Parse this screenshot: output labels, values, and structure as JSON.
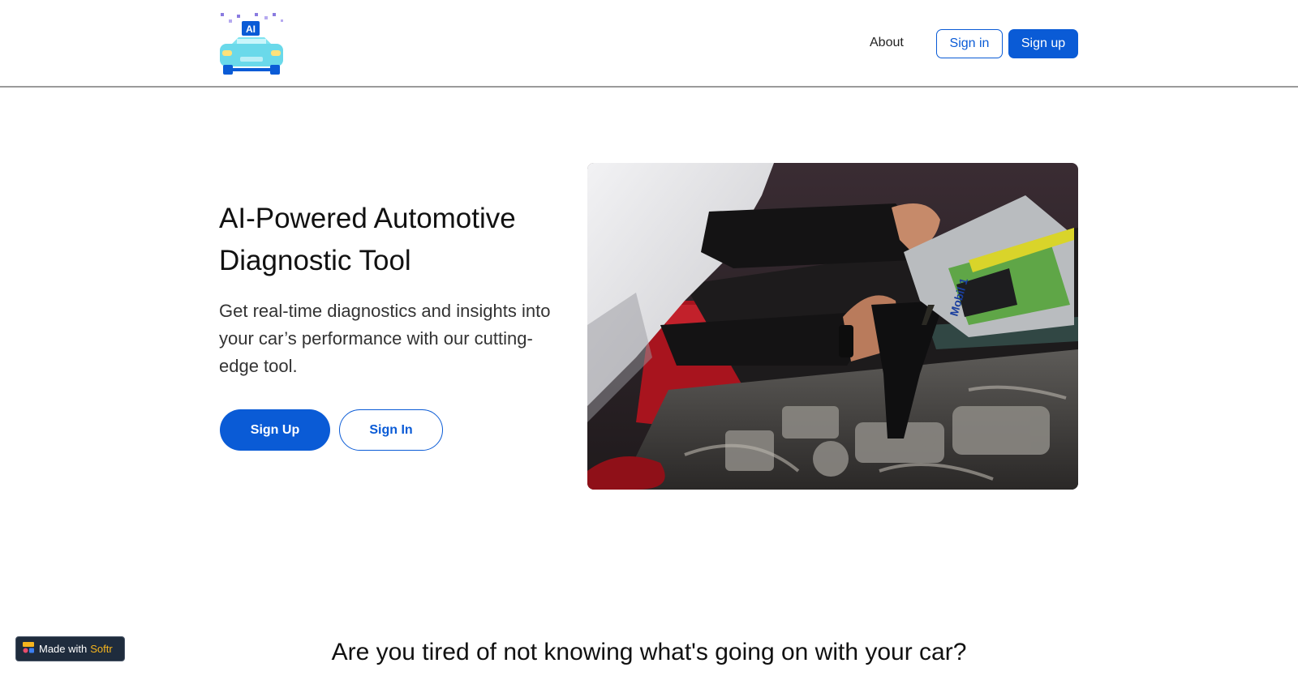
{
  "navbar": {
    "logo_text": "AI",
    "about_label": "About",
    "signin_label": "Sign in",
    "signup_label": "Sign up"
  },
  "hero": {
    "title": "AI-Powered Automotive Diagnostic Tool",
    "subtitle": "Get real-time diagnostics and insights into your car’s performance with our cutting-edge tool.",
    "signup_label": "Sign Up",
    "signin_label": "Sign In",
    "image_bottle_text": "Mobil 1"
  },
  "section": {
    "title": "Are you tired of not knowing what's going on with your car?"
  },
  "badge": {
    "prefix": "Made with",
    "brand": "Softr"
  },
  "colors": {
    "primary": "#0a5bd6",
    "navbar_border": "#9a9a9a",
    "badge_bg": "#1f2c3d",
    "badge_brand": "#f6b51e"
  },
  "icons": [
    "ai-car-logo-icon",
    "softr-logo-icon"
  ]
}
